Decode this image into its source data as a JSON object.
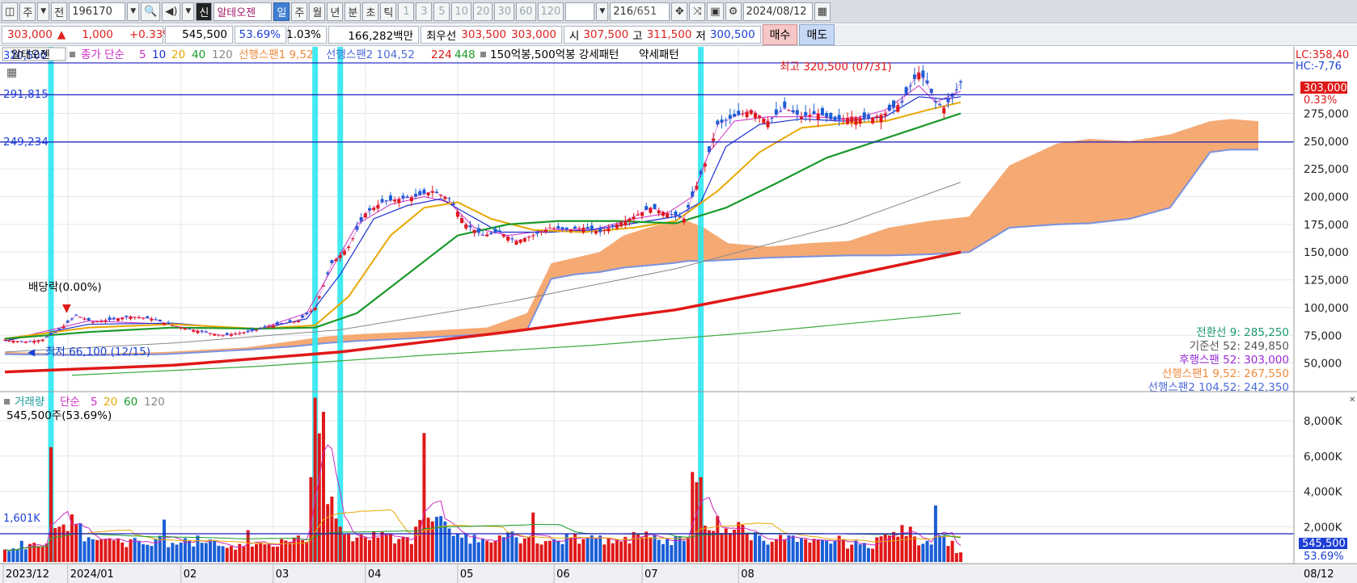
{
  "toolbar": {
    "period_main": "주",
    "prev_label": "전",
    "code": "196170",
    "credit_badge": "신",
    "stock_name": "알테오젠",
    "intervals": [
      "일",
      "주",
      "월",
      "년",
      "분",
      "초",
      "틱"
    ],
    "active_interval": "일",
    "numbers": [
      "1",
      "3",
      "5",
      "10",
      "20",
      "30",
      "60",
      "120"
    ],
    "count": "216",
    "total": "/651",
    "date": "2024/08/12"
  },
  "quote": {
    "price": "303,000",
    "arrow": "▲",
    "change": "1,000",
    "change_pct": "+0.33%",
    "volume": "545,500",
    "turnover_pct": "53.69%",
    "ratio": "1.03%",
    "amount": "166,282백만",
    "best_label": "최우선",
    "best_ask": "303,500",
    "best_bid": "303,000",
    "open_label": "시",
    "open": "307,500",
    "high_label": "고",
    "high": "311,500",
    "low_label": "저",
    "low": "300,500",
    "buy": "매수",
    "sell": "매도"
  },
  "chart_data": {
    "type": "candlestick",
    "stock": "알테오젠",
    "legend": {
      "name_box": "알테오젠",
      "close": "종가 단순",
      "ma": [
        "5",
        "10",
        "20",
        "40",
        "120"
      ],
      "span1": "선행스팬1 9,52",
      "span2": "선행스팬2 104,52",
      "long_ma": [
        "224",
        "448"
      ],
      "pattern": "150억봉,500억봉 강세패턴",
      "weak": "약세패턴"
    },
    "colors": {
      "ma5": "#cc2bc4",
      "ma10": "#1a2fd0",
      "ma20": "#e8a800",
      "ma40": "#1a9a2a",
      "ma120": "#888888",
      "ma224": "#e01818",
      "ma448": "#3aa83a",
      "cloud": "#f4a46c",
      "span2": "#7a93e0",
      "up": "#e01818",
      "down": "#1a5ed6",
      "highlight": "#2ee8f0"
    },
    "price_axis": {
      "ticks": [
        "275,000",
        "250,000",
        "225,000",
        "200,000",
        "175,000",
        "150,000",
        "125,000",
        "100,000",
        "75,000",
        "50,000"
      ],
      "ylim": [
        25000,
        335000
      ]
    },
    "price_lines": [
      "291,815",
      "249,234"
    ],
    "top_left_label": "320,500",
    "right_labels": {
      "lc": "LC:358,40",
      "hc": "HC:-7,76",
      "price": "303,000",
      "pct": "0.33%"
    },
    "annotations": {
      "high": "최고 320,500 (07/31)",
      "low": "최저 66,100 (12/15)",
      "dividend": "배당락(0.00%)"
    },
    "ichimoku": [
      {
        "label": "전환선 9:",
        "value": "285,250",
        "color": "#1a9a6a"
      },
      {
        "label": "기준선 52:",
        "value": "249,850",
        "color": "#555555"
      },
      {
        "label": "후행스팬 52:",
        "value": "303,000",
        "color": "#9a2bd6"
      },
      {
        "label": "선행스팬1 9,52:",
        "value": "267,550",
        "color": "#f08a3c"
      },
      {
        "label": "선행스팬2 104,52:",
        "value": "242,350",
        "color": "#4a6ad6"
      }
    ],
    "x_labels": [
      "2023/12",
      "2024/01",
      "02",
      "03",
      "04",
      "05",
      "06",
      "07",
      "08"
    ],
    "x_right": "08/12",
    "series": [
      {
        "name": "종가",
        "points": [
          [
            0,
            71000
          ],
          [
            2,
            70000
          ],
          [
            5,
            69000
          ],
          [
            9,
            71000
          ],
          [
            13,
            80000
          ],
          [
            17,
            93000
          ],
          [
            21,
            87000
          ],
          [
            25,
            89000
          ],
          [
            30,
            92000
          ],
          [
            35,
            90000
          ],
          [
            40,
            84000
          ],
          [
            46,
            79000
          ],
          [
            52,
            75000
          ],
          [
            58,
            78000
          ],
          [
            64,
            84000
          ],
          [
            70,
            88000
          ],
          [
            74,
            100000
          ],
          [
            78,
            140000
          ],
          [
            82,
            155000
          ],
          [
            86,
            185000
          ],
          [
            90,
            195000
          ],
          [
            94,
            198000
          ],
          [
            98,
            200000
          ],
          [
            102,
            205000
          ],
          [
            106,
            198000
          ],
          [
            110,
            175000
          ],
          [
            114,
            165000
          ],
          [
            118,
            168000
          ],
          [
            122,
            160000
          ],
          [
            126,
            165000
          ],
          [
            130,
            172000
          ],
          [
            134,
            170000
          ],
          [
            138,
            172000
          ],
          [
            142,
            168000
          ],
          [
            146,
            175000
          ],
          [
            150,
            182000
          ],
          [
            154,
            190000
          ],
          [
            158,
            185000
          ],
          [
            162,
            180000
          ],
          [
            166,
            220000
          ],
          [
            168,
            240000
          ],
          [
            170,
            265000
          ],
          [
            174,
            272000
          ],
          [
            178,
            278000
          ],
          [
            182,
            268000
          ],
          [
            186,
            280000
          ],
          [
            190,
            272000
          ],
          [
            194,
            275000
          ],
          [
            198,
            268000
          ],
          [
            202,
            272000
          ],
          [
            206,
            270000
          ],
          [
            210,
            275000
          ],
          [
            214,
            285000
          ],
          [
            216,
            300000
          ],
          [
            218,
            312000
          ],
          [
            220,
            302000
          ],
          [
            222,
            285000
          ],
          [
            224,
            280000
          ],
          [
            226,
            290000
          ],
          [
            228,
            303000
          ]
        ]
      },
      {
        "name": "5",
        "points": [
          [
            0,
            70000
          ],
          [
            20,
            88000
          ],
          [
            40,
            85000
          ],
          [
            60,
            80000
          ],
          [
            72,
            95000
          ],
          [
            78,
            135000
          ],
          [
            84,
            175000
          ],
          [
            92,
            193000
          ],
          [
            100,
            200000
          ],
          [
            106,
            195000
          ],
          [
            112,
            172000
          ],
          [
            120,
            165000
          ],
          [
            130,
            170000
          ],
          [
            140,
            170000
          ],
          [
            150,
            180000
          ],
          [
            158,
            185000
          ],
          [
            164,
            200000
          ],
          [
            168,
            240000
          ],
          [
            174,
            268000
          ],
          [
            182,
            272000
          ],
          [
            192,
            272000
          ],
          [
            202,
            270000
          ],
          [
            210,
            278000
          ],
          [
            218,
            300000
          ],
          [
            222,
            285000
          ],
          [
            228,
            295000
          ]
        ]
      },
      {
        "name": "10",
        "points": [
          [
            0,
            70000
          ],
          [
            20,
            85000
          ],
          [
            40,
            86000
          ],
          [
            60,
            80000
          ],
          [
            72,
            90000
          ],
          [
            80,
            130000
          ],
          [
            88,
            180000
          ],
          [
            96,
            192000
          ],
          [
            104,
            198000
          ],
          [
            110,
            185000
          ],
          [
            118,
            168000
          ],
          [
            130,
            168000
          ],
          [
            140,
            170000
          ],
          [
            150,
            176000
          ],
          [
            160,
            182000
          ],
          [
            166,
            195000
          ],
          [
            172,
            245000
          ],
          [
            180,
            265000
          ],
          [
            190,
            270000
          ],
          [
            200,
            268000
          ],
          [
            210,
            272000
          ],
          [
            218,
            290000
          ],
          [
            224,
            288000
          ],
          [
            228,
            290000
          ]
        ]
      },
      {
        "name": "20",
        "points": [
          [
            0,
            72000
          ],
          [
            20,
            82000
          ],
          [
            40,
            85000
          ],
          [
            60,
            81000
          ],
          [
            74,
            84000
          ],
          [
            82,
            110000
          ],
          [
            92,
            165000
          ],
          [
            100,
            190000
          ],
          [
            108,
            195000
          ],
          [
            116,
            180000
          ],
          [
            126,
            170000
          ],
          [
            138,
            168000
          ],
          [
            150,
            172000
          ],
          [
            160,
            178000
          ],
          [
            170,
            205000
          ],
          [
            180,
            240000
          ],
          [
            190,
            262000
          ],
          [
            200,
            266000
          ],
          [
            210,
            268000
          ],
          [
            220,
            278000
          ],
          [
            228,
            285000
          ]
        ]
      },
      {
        "name": "40",
        "points": [
          [
            0,
            72000
          ],
          [
            20,
            78000
          ],
          [
            40,
            82000
          ],
          [
            60,
            81000
          ],
          [
            74,
            82000
          ],
          [
            84,
            95000
          ],
          [
            96,
            130000
          ],
          [
            108,
            165000
          ],
          [
            120,
            175000
          ],
          [
            132,
            178000
          ],
          [
            146,
            178000
          ],
          [
            160,
            176000
          ],
          [
            172,
            190000
          ],
          [
            184,
            212000
          ],
          [
            196,
            235000
          ],
          [
            208,
            250000
          ],
          [
            220,
            265000
          ],
          [
            228,
            275000
          ]
        ]
      },
      {
        "name": "120",
        "points": [
          [
            0,
            60000
          ],
          [
            40,
            68000
          ],
          [
            80,
            80000
          ],
          [
            120,
            105000
          ],
          [
            160,
            135000
          ],
          [
            200,
            175000
          ],
          [
            228,
            213000
          ]
        ]
      },
      {
        "name": "224",
        "points": [
          [
            0,
            42000
          ],
          [
            40,
            48000
          ],
          [
            80,
            60000
          ],
          [
            120,
            78000
          ],
          [
            160,
            98000
          ],
          [
            190,
            120000
          ],
          [
            228,
            150000
          ]
        ]
      },
      {
        "name": "448",
        "points": [
          [
            16,
            39000
          ],
          [
            60,
            47000
          ],
          [
            100,
            57000
          ],
          [
            140,
            66000
          ],
          [
            180,
            78000
          ],
          [
            228,
            95000
          ]
        ]
      }
    ],
    "volume_axis": {
      "ticks": [
        "8,000K",
        "6,000K",
        "4,000K",
        "2,000K"
      ],
      "ylim": [
        0,
        9600
      ]
    },
    "volume_legend": {
      "title": "거래량",
      "mode": "단순",
      "ma": [
        "5",
        "20",
        "60",
        "120"
      ],
      "current": "545,500주(53.69%)",
      "ref": "1,601K"
    },
    "volume_right": {
      "value": "545,500",
      "pct": "53.69%"
    },
    "volume": [
      [
        0,
        700
      ],
      [
        4,
        1200
      ],
      [
        8,
        900
      ],
      [
        11,
        6500
      ],
      [
        13,
        2000
      ],
      [
        16,
        2700
      ],
      [
        18,
        2200
      ],
      [
        20,
        1400
      ],
      [
        24,
        1300
      ],
      [
        28,
        1100
      ],
      [
        32,
        1200
      ],
      [
        36,
        1300
      ],
      [
        38,
        2400
      ],
      [
        42,
        1100
      ],
      [
        46,
        1500
      ],
      [
        50,
        1200
      ],
      [
        54,
        900
      ],
      [
        58,
        1800
      ],
      [
        62,
        1000
      ],
      [
        66,
        1300
      ],
      [
        70,
        1500
      ],
      [
        73,
        4800
      ],
      [
        74,
        9300
      ],
      [
        76,
        8500
      ],
      [
        78,
        3700
      ],
      [
        80,
        2000
      ],
      [
        82,
        1600
      ],
      [
        86,
        1400
      ],
      [
        90,
        1700
      ],
      [
        94,
        1300
      ],
      [
        98,
        2000
      ],
      [
        100,
        7300
      ],
      [
        102,
        2300
      ],
      [
        104,
        2600
      ],
      [
        106,
        1900
      ],
      [
        110,
        1600
      ],
      [
        114,
        1300
      ],
      [
        118,
        1500
      ],
      [
        122,
        1400
      ],
      [
        126,
        2800
      ],
      [
        130,
        1200
      ],
      [
        134,
        1600
      ],
      [
        138,
        1300
      ],
      [
        142,
        1500
      ],
      [
        146,
        1300
      ],
      [
        150,
        1700
      ],
      [
        154,
        1400
      ],
      [
        158,
        1300
      ],
      [
        162,
        1200
      ],
      [
        164,
        5100
      ],
      [
        166,
        4800
      ],
      [
        168,
        1800
      ],
      [
        170,
        2600
      ],
      [
        172,
        1900
      ],
      [
        176,
        2100
      ],
      [
        180,
        1500
      ],
      [
        184,
        1300
      ],
      [
        188,
        1500
      ],
      [
        192,
        1100
      ],
      [
        196,
        1200
      ],
      [
        200,
        1300
      ],
      [
        204,
        1000
      ],
      [
        208,
        1400
      ],
      [
        212,
        1700
      ],
      [
        216,
        2000
      ],
      [
        220,
        1200
      ],
      [
        222,
        3200
      ],
      [
        224,
        1500
      ],
      [
        226,
        1200
      ],
      [
        228,
        545
      ]
    ]
  }
}
